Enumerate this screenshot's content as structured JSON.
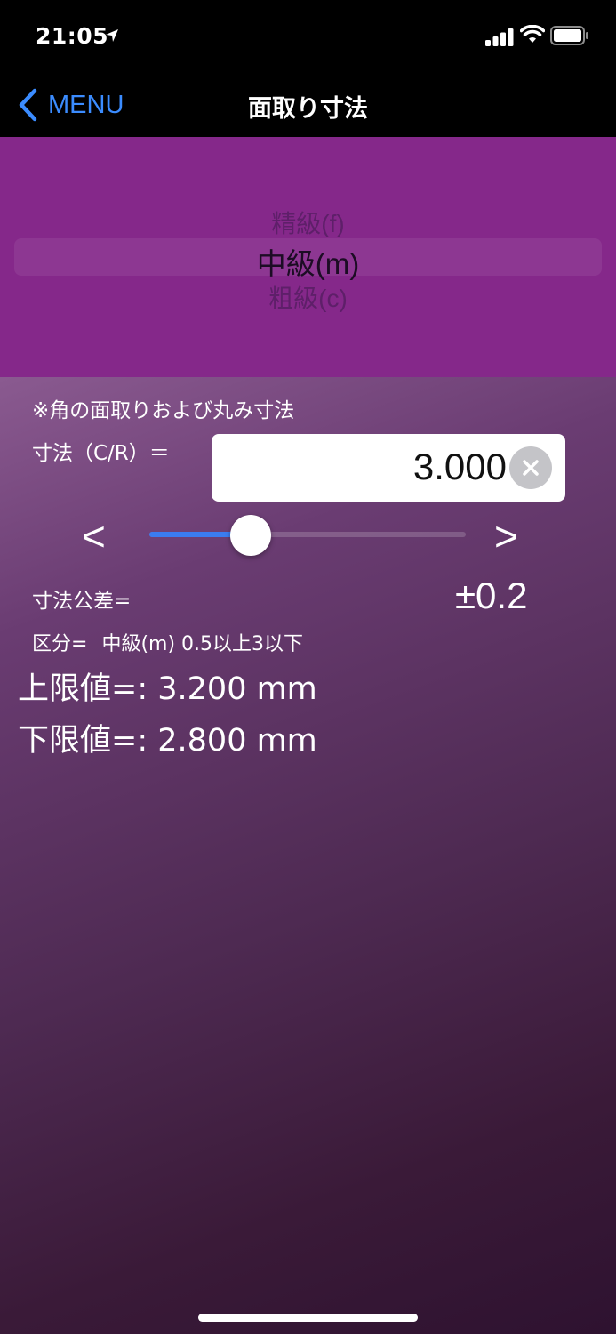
{
  "status": {
    "time": "21:05",
    "icons": [
      "location-icon",
      "signal-icon",
      "wifi-icon",
      "battery-icon"
    ]
  },
  "nav": {
    "back_label": "MENU",
    "title": "面取り寸法"
  },
  "picker": {
    "items": [
      "精級(f)",
      "中級(m)",
      "粗級(c)"
    ],
    "selected": "中級(m)"
  },
  "main": {
    "note": "※角の面取りおよび丸み寸法",
    "dimension_label": "寸法（C/R）＝",
    "dimension_value": "3.000",
    "decrement_label": "<",
    "increment_label": ">",
    "slider_fraction": 0.32,
    "tolerance_label": "寸法公差=",
    "tolerance_value": "±0.2",
    "class_label": "区分=",
    "class_value": "中級(m) 0.5以上3以下",
    "upper_label": "上限値=:",
    "upper_value": "3.200 mm",
    "lower_label": "下限値=:",
    "lower_value": "2.800 mm"
  },
  "colors": {
    "accent": "#3b8cff",
    "picker_bg": "#85288a",
    "slider_fill": "#3b7cf0"
  }
}
